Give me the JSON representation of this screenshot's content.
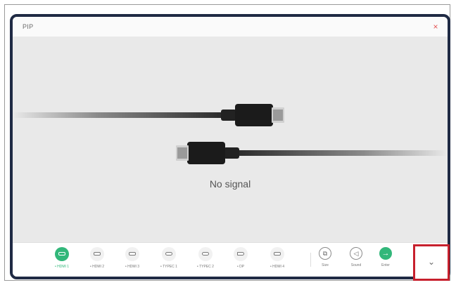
{
  "window": {
    "title": "PIP",
    "close_glyph": "×"
  },
  "main": {
    "status_text": "No signal"
  },
  "toolbar": {
    "sources": [
      {
        "label": "• HDMI 1",
        "icon": "hdmi-port-icon",
        "active": true
      },
      {
        "label": "• HDMI 2",
        "icon": "hdmi-port-icon",
        "active": false
      },
      {
        "label": "• HDMI 3",
        "icon": "hdmi-port-icon",
        "active": false
      },
      {
        "label": "• TYPEC 1",
        "icon": "typec-port-icon",
        "active": false
      },
      {
        "label": "• TYPEC 2",
        "icon": "typec-port-icon",
        "active": false
      },
      {
        "label": "• DP",
        "icon": "dp-port-icon",
        "active": false
      },
      {
        "label": "• HDMI 4",
        "icon": "hdmi-port-icon",
        "active": false
      }
    ],
    "actions": [
      {
        "label": "Size",
        "icon": "size-icon",
        "glyph": "⧉"
      },
      {
        "label": "Sound",
        "icon": "speaker-icon",
        "glyph": "◁"
      },
      {
        "label": "Enter",
        "icon": "arrow-right-icon",
        "glyph": "→"
      }
    ],
    "expand_glyph": "⌄"
  },
  "colors": {
    "accent": "#32b77a",
    "highlight_border": "#c7202d",
    "close": "#e45757"
  }
}
